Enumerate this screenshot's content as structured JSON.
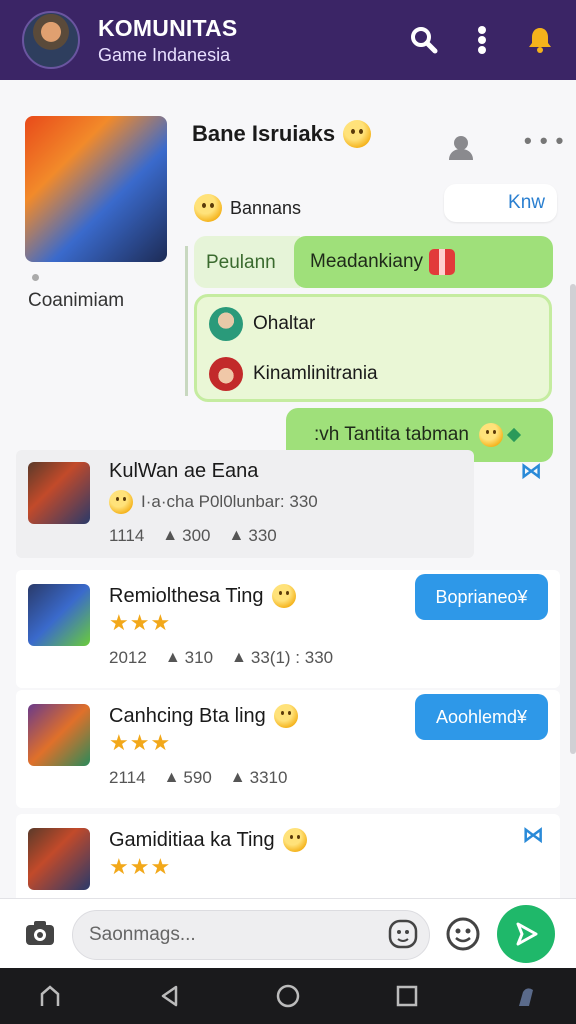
{
  "header": {
    "title": "KOMUNITAS",
    "subtitle": "Game Indanesia",
    "logo_icon": "game-avatar-icon",
    "search_icon": "search-icon",
    "more_icon": "kebab-menu-icon",
    "notify_icon": "bell-icon"
  },
  "post": {
    "title": "Bane Isruiaks",
    "author": "Coanimiam",
    "sub_label": "Bannans",
    "know_button": "Knw",
    "chip_pale": "Peulann",
    "chip_main": "Meadankiany",
    "replies": [
      {
        "name": "Ohaltar"
      },
      {
        "name": "Kinamlinitrania"
      }
    ],
    "outgoing": ":vh Tantita tabman"
  },
  "cards": [
    {
      "title": "KulWan ae Eana",
      "meta": "I·a·cha P0l0lunbar: 330",
      "stats": [
        "1114",
        "300",
        "330"
      ]
    },
    {
      "title": "Remiolthesa Ting",
      "stars": "★★★",
      "stats": [
        "2012",
        "310",
        "33(1) : 330"
      ],
      "button": "Boprianeo¥"
    },
    {
      "title": "Canhcing Bta ling",
      "stars": "★★★",
      "stats": [
        "2114",
        "590",
        "3310"
      ],
      "button": "Aoohlemd¥"
    },
    {
      "title": "Gamiditiaa ka Ting",
      "stars": "★★★"
    }
  ],
  "composer": {
    "placeholder": "Saonmags...",
    "value": ""
  },
  "colors": {
    "header_bg": "#3b2566",
    "chip_green": "#9fe07a",
    "accent_blue": "#2e98e8",
    "send_green": "#1fb86a",
    "star_gold": "#f2a81a"
  }
}
